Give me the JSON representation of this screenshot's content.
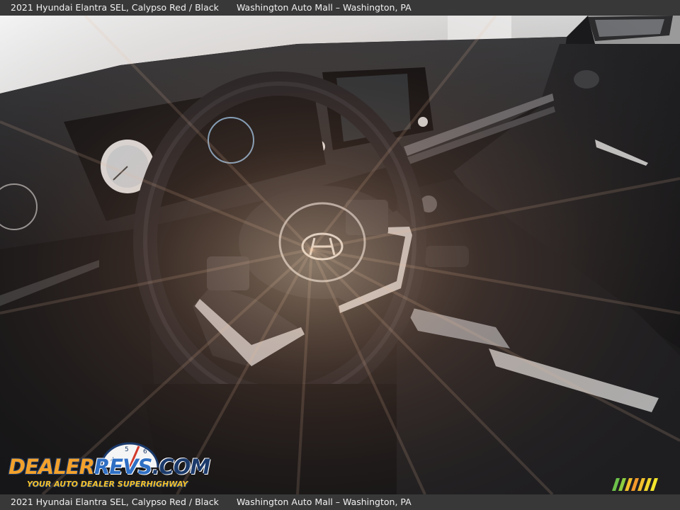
{
  "caption": {
    "vehicle": "2021 Hyundai Elantra SEL,  Calypso Red / Black",
    "dealer": "Washington Auto Mall – Washington, PA"
  },
  "watermark": {
    "brand": "DealerRevs.com",
    "tagline": "YOUR AUTO DEALER SUPERHIGHWAY"
  },
  "colors": {
    "caption_bg": "#3c3c3c",
    "logo_orange": "#f2a12c",
    "logo_blue": "#2f6fc4"
  }
}
